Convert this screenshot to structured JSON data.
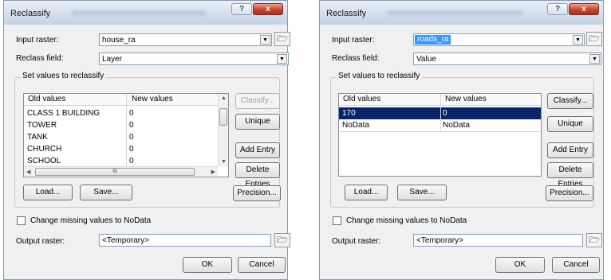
{
  "dialogs": [
    {
      "title": "Reclassify",
      "input_raster_label": "Input raster:",
      "input_raster_value": "house_ra",
      "reclass_field_label": "Reclass field:",
      "reclass_field_value": "Layer",
      "group_title": "Set values to reclassify",
      "columns": [
        "Old values",
        "New values"
      ],
      "rows": [
        {
          "old": "CLASS 1 BUILDING",
          "new": "0"
        },
        {
          "old": "TOWER",
          "new": "0"
        },
        {
          "old": "TANK",
          "new": "0"
        },
        {
          "old": "CHURCH",
          "new": "0"
        },
        {
          "old": "SCHOOL",
          "new": "0"
        }
      ],
      "buttons": {
        "classify": "Classify...",
        "unique": "Unique",
        "add_entry": "Add Entry",
        "delete_entries": "Delete Entries",
        "load": "Load...",
        "save": "Save...",
        "precision": "Precision...",
        "ok": "OK",
        "cancel": "Cancel"
      },
      "checkbox_label": "Change missing values to NoData",
      "output_raster_label": "Output raster:",
      "output_raster_value": "<Temporary>",
      "hscroll_glyph": "III"
    },
    {
      "title": "Reclassify",
      "input_raster_label": "Input raster:",
      "input_raster_value": "roads_ra",
      "reclass_field_label": "Reclass field:",
      "reclass_field_value": "Value",
      "group_title": "Set values to reclassify",
      "columns": [
        "Old values",
        "New values"
      ],
      "rows": [
        {
          "old": "170",
          "new": "0"
        },
        {
          "old": "NoData",
          "new": "NoData"
        }
      ],
      "buttons": {
        "classify": "Classify...",
        "unique": "Unique",
        "add_entry": "Add Entry",
        "delete_entries": "Delete Entries",
        "load": "Load...",
        "save": "Save...",
        "precision": "Precision...",
        "ok": "OK",
        "cancel": "Cancel"
      },
      "checkbox_label": "Change missing values to NoData",
      "output_raster_label": "Output raster:",
      "output_raster_value": "<Temporary>"
    }
  ],
  "glyphs": {
    "help": "?",
    "close": "x",
    "dropdown": "▼",
    "folder": "🗁",
    "scroll_up": "▲",
    "scroll_down": "▼",
    "scroll_left": "◀",
    "scroll_right": "▶"
  },
  "colors": {
    "selection": "#0a246a",
    "dialog_bg": "#f0f0f0",
    "close_button": "#c8442c"
  }
}
